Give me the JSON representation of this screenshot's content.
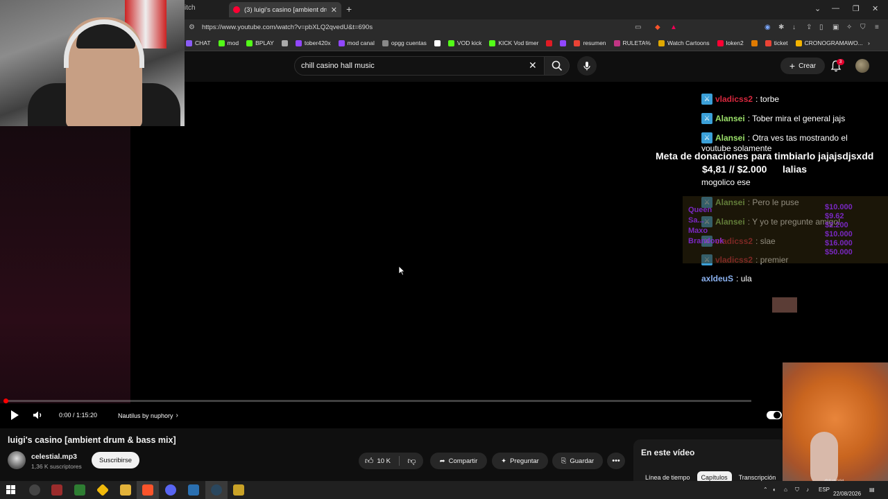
{
  "browser": {
    "prev_tab_fragment": "itch",
    "active_tab_title": "(3) luigi's casino [ambient drum ...",
    "url": "https://www.youtube.com/watch?v=pbXLQ2qvedU&t=690s",
    "bookmarks": [
      {
        "label": "CHAT",
        "color": "#8a5cf6"
      },
      {
        "label": "mod",
        "color": "#53fc18"
      },
      {
        "label": "BPLAY",
        "color": "#53fc18"
      },
      {
        "label": "",
        "color": "#aaaaaa"
      },
      {
        "label": "tober420x",
        "color": "#9147ff"
      },
      {
        "label": "mod canal",
        "color": "#9147ff"
      },
      {
        "label": "opgg cuentas",
        "color": "#888888"
      },
      {
        "label": "",
        "color": "#ffffff"
      },
      {
        "label": "VOD kick",
        "color": "#53fc18"
      },
      {
        "label": "KICK Vod timer",
        "color": "#53fc18"
      },
      {
        "label": "",
        "color": "#e01b24"
      },
      {
        "label": "",
        "color": "#9147ff"
      },
      {
        "label": "resumen",
        "color": "#ea4335"
      },
      {
        "label": "RULETA%",
        "color": "#c13584"
      },
      {
        "label": "Watch Cartoons",
        "color": "#e0a800"
      },
      {
        "label": "loken2",
        "color": "#ff0033"
      },
      {
        "label": "",
        "color": "#e07b00"
      },
      {
        "label": "ticket",
        "color": "#ea4335"
      },
      {
        "label": "CRONOGRAMAWO...",
        "color": "#f4b400"
      }
    ]
  },
  "header": {
    "search_value": "chill casino hall music",
    "create_label": "Crear",
    "notification_count": "3"
  },
  "chat": {
    "messages": [
      {
        "user": "vladicss2",
        "user_color": "red",
        "text": ": torbe"
      },
      {
        "user": "Alansei",
        "user_color": "green",
        "text": ": Tober mira el general jajs"
      },
      {
        "user": "Alansei",
        "user_color": "green",
        "text": ": Otra ves tas mostrando el"
      },
      {
        "user": "",
        "user_color": "none",
        "text": "mogolico ese"
      },
      {
        "user": "Alansei",
        "user_color": "green",
        "text": ": Pero le puse"
      },
      {
        "user": "Alansei",
        "user_color": "green",
        "text": ": Y yo te pregunte amigo!"
      },
      {
        "user": "vladicss2",
        "user_color": "red",
        "text": ": slae"
      },
      {
        "user": "vladicss2",
        "user_color": "red",
        "text": ": premier"
      },
      {
        "user": "axldeuS",
        "user_color": "blue",
        "text": ": ula"
      }
    ],
    "cut_line": "youtube solamente"
  },
  "donation_goal": {
    "title": "Meta de donaciones para timbiarlo jajajsdjsxdd",
    "progress": "$4,81 //  $2.000",
    "name": "lalias"
  },
  "donor_overlay": {
    "names": [
      "Queen",
      "Sa...",
      "Maxo",
      "Brandonk"
    ],
    "amounts": [
      "$10.000",
      "$9.62",
      "$2.200",
      "$10.000",
      "$16.000",
      "$50.000"
    ]
  },
  "player": {
    "time": "0:00 / 1:15:20",
    "chapter": "Nautilus by nuphory",
    "progress_fraction": 0.0
  },
  "video": {
    "title": "luigi's casino [ambient drum & bass mix]",
    "channel": "celestial.mp3",
    "subscribers": "1,36 K suscriptores",
    "subscribe_label": "Suscribirse",
    "likes": "10 K",
    "share_label": "Compartir",
    "ask_label": "Preguntar",
    "save_label": "Guardar"
  },
  "side_panel": {
    "title": "En este vídeo",
    "tabs": [
      "Línea de tiempo",
      "Capítulos",
      "Transcripción"
    ],
    "active_tab": "Capítulos"
  },
  "overlay_cam": {
    "credit": "@SatisVid"
  },
  "taskbar": {
    "language": "ESP",
    "date": "22/08/2026"
  }
}
